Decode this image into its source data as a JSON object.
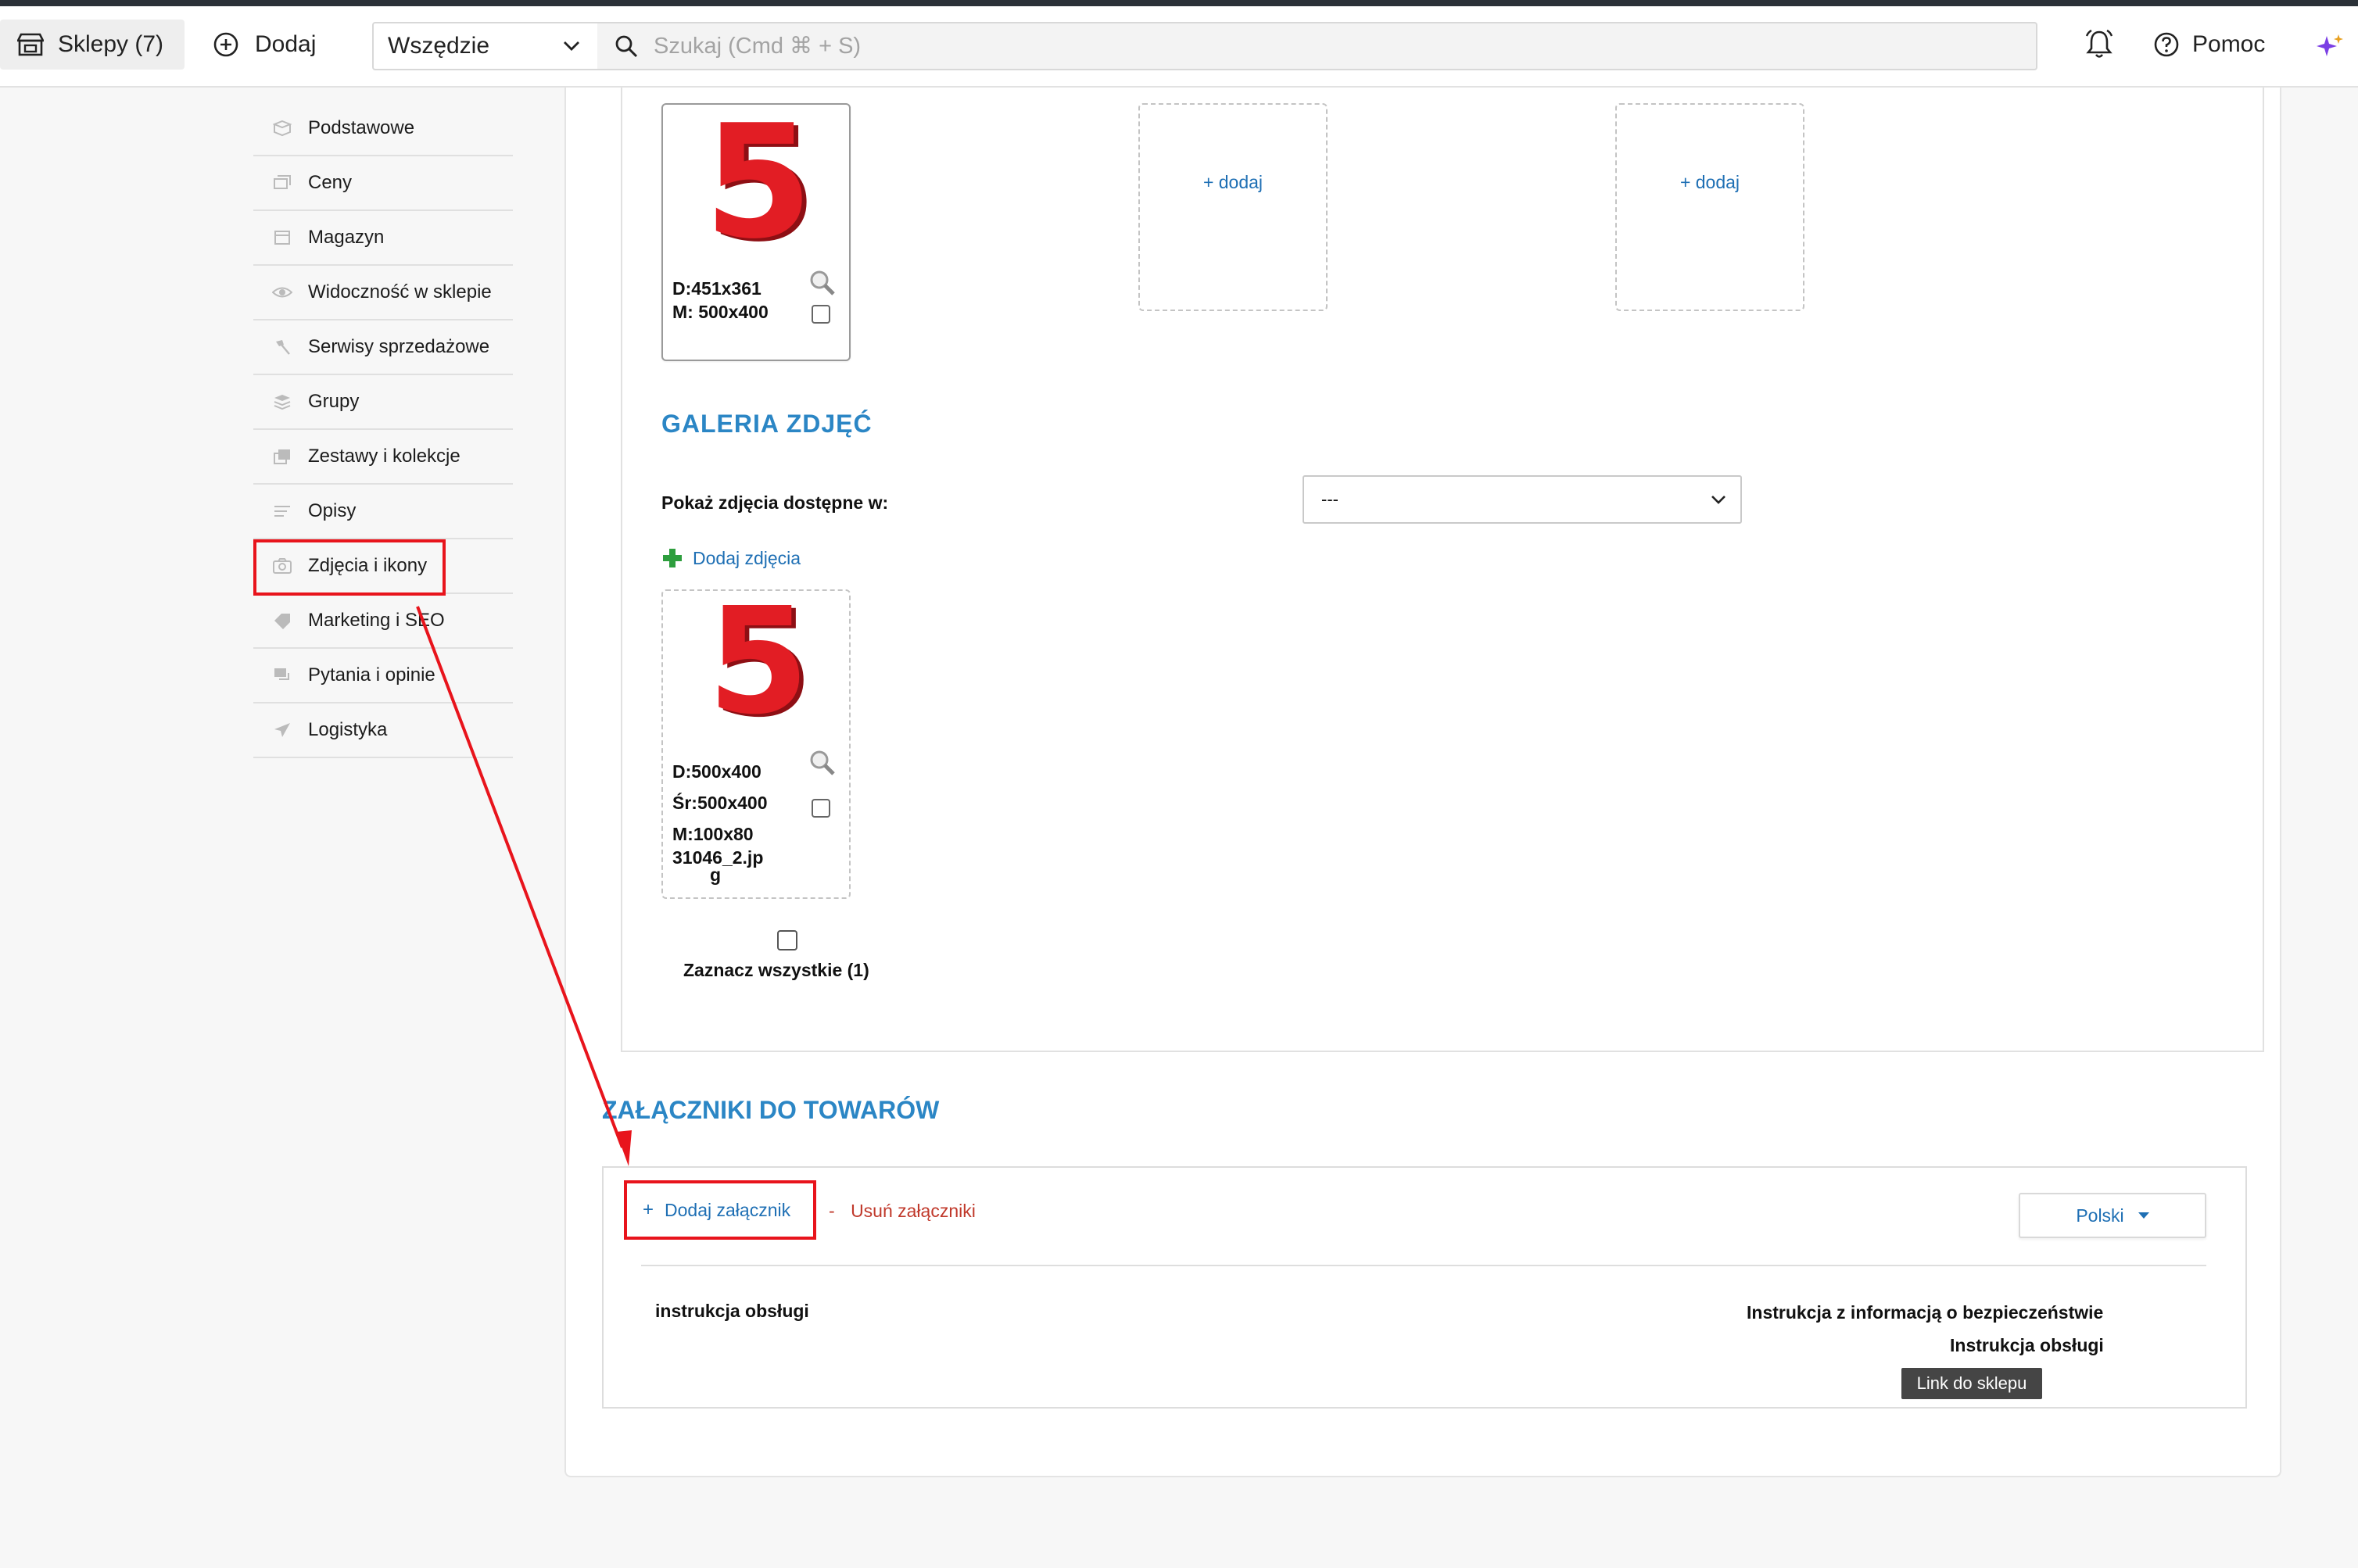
{
  "header": {
    "shops_label": "Sklepy (7)",
    "add_label": "Dodaj",
    "scope_value": "Wszędzie",
    "search_placeholder": "Szukaj (Cmd ⌘ + S)",
    "help_label": "Pomoc"
  },
  "sidebar": {
    "items": [
      {
        "label": "Podstawowe",
        "icon": "box-icon"
      },
      {
        "label": "Ceny",
        "icon": "price-icon"
      },
      {
        "label": "Magazyn",
        "icon": "warehouse-icon"
      },
      {
        "label": "Widoczność w sklepie",
        "icon": "eye-icon"
      },
      {
        "label": "Serwisy sprzedażowe",
        "icon": "hammer-icon"
      },
      {
        "label": "Grupy",
        "icon": "layers-icon"
      },
      {
        "label": "Zestawy i kolekcje",
        "icon": "collection-icon"
      },
      {
        "label": "Opisy",
        "icon": "text-icon"
      },
      {
        "label": "Zdjęcia i ikony",
        "icon": "camera-icon"
      },
      {
        "label": "Marketing i SEO",
        "icon": "tag-icon"
      },
      {
        "label": "Pytania i opinie",
        "icon": "chat-icon"
      },
      {
        "label": "Logistyka",
        "icon": "send-icon"
      }
    ],
    "active_index": 8
  },
  "main_image": {
    "dims_d": "D:451x361",
    "dims_m": "M: 500x400",
    "add_slot_1": "+ dodaj",
    "add_slot_2": "+ dodaj",
    "image_glyph": "5"
  },
  "gallery": {
    "title": "GALERIA ZDJĘĆ",
    "show_label": "Pokaż zdjęcia dostępne w:",
    "select_value": "---",
    "add_photos": "Dodaj zdjęcia",
    "photo": {
      "glyph": "5",
      "dims_d": "D:500x400",
      "dims_sr": "Śr:500x400",
      "dims_m": "M:100x80",
      "filename_1": "31046_2.jp",
      "filename_2": "g"
    },
    "select_all": "Zaznacz wszystkie (1)"
  },
  "attachments": {
    "title": "ZAŁĄCZNIKI DO TOWARÓW",
    "add_label": "Dodaj załącznik",
    "remove_label": "Usuń załączniki",
    "language": "Polski",
    "item_name": "instrukcja obsługi",
    "info_line_1": "Instrukcja z informacją o bezpieczeństwie",
    "info_line_2": "Instrukcja obsługi",
    "tooltip": "Link do sklepu"
  },
  "colors": {
    "accent_blue": "#2b86c5",
    "link_blue": "#1e6fb4",
    "highlight_red": "#e8141c",
    "remove_red": "#c0392b",
    "add_green": "#2e9e3e"
  }
}
